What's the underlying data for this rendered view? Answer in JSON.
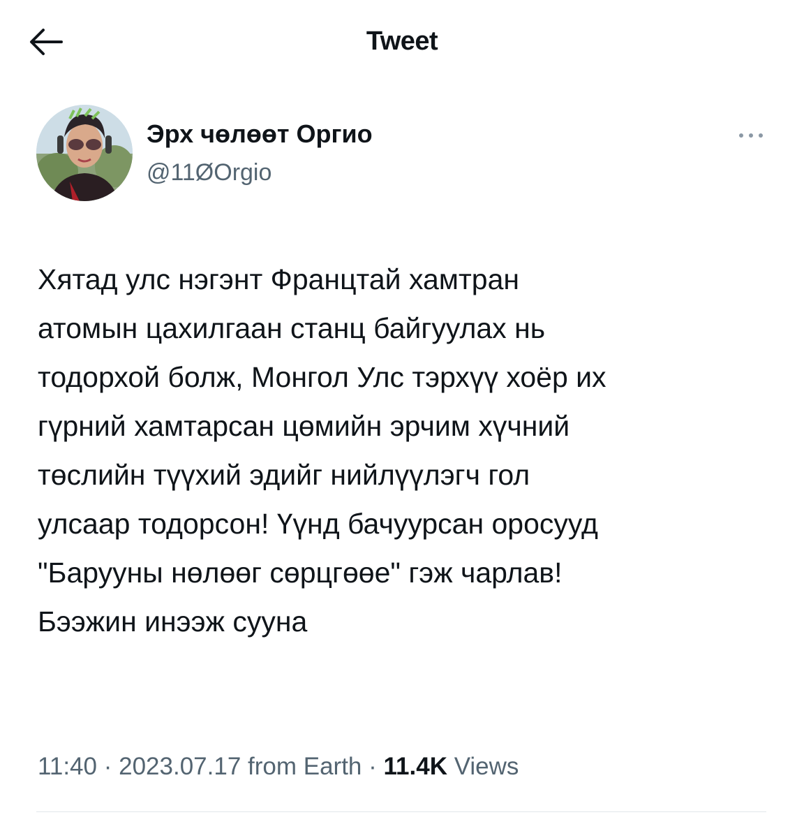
{
  "header": {
    "title": "Tweet",
    "back_icon": "arrow-left-icon"
  },
  "author": {
    "display_name": "Эрх чөлөөт Оргио",
    "handle": "@11ØOrgio",
    "more_icon": "more-dots-icon"
  },
  "tweet": {
    "text": "Хятад улс нэгэнт Францтай хамтран\nатомын цахилгаан станц байгуулах нь\nтодорхой болж, Монгол Улс тэрхүү хоёр их\nгүрний хамтарсан цөмийн эрчим хүчний\nтөслийн түүхий эдийг нийлүүлэгч гол\nулсаар тодорсон! Үүнд бачуурсан оросууд\n\"Барууны нөлөөг сөрцгөөе\" гэж чарлав!\nБээжин инээж сууна"
  },
  "meta": {
    "time": "11:40",
    "separator1": " · ",
    "date": "2023.07.17",
    "source": " from Earth",
    "separator2": " · ",
    "views_count": "11.4K",
    "views_label": " Views"
  },
  "colors": {
    "text": "#0f1419",
    "secondary": "#536471",
    "divider": "#e1e6ea"
  }
}
